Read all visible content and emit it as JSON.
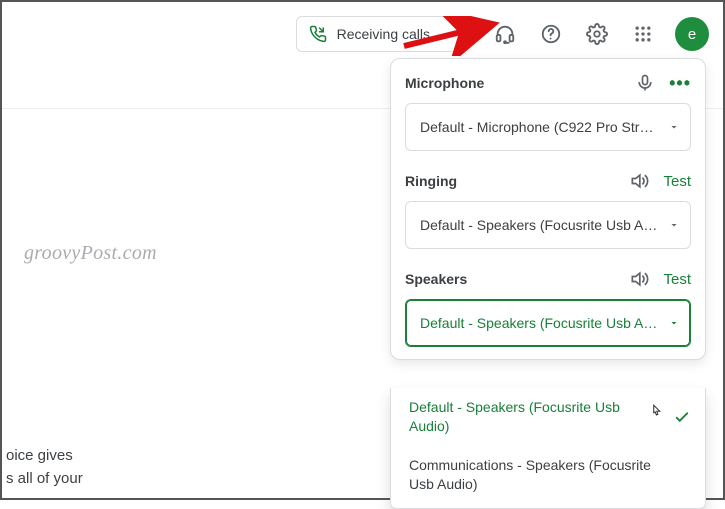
{
  "topbar": {
    "call_chip_label": "Receiving calls",
    "avatar_letter": "e"
  },
  "watermark": "groovyPost.com",
  "footer": {
    "line1": "oice gives",
    "line2": "s all of your"
  },
  "audio_panel": {
    "microphone": {
      "title": "Microphone",
      "selected": "Default - Microphone (C922 Pro Strea…"
    },
    "ringing": {
      "title": "Ringing",
      "test_label": "Test",
      "selected": "Default - Speakers (Focusrite Usb Aud…"
    },
    "speakers": {
      "title": "Speakers",
      "test_label": "Test",
      "selected": "Default - Speakers (Focusrite Usb Aud…",
      "options": [
        "Default - Speakers (Focusrite Usb Audio)",
        "Communications - Speakers (Focusrite Usb Audio)"
      ],
      "selected_index": 0
    }
  }
}
